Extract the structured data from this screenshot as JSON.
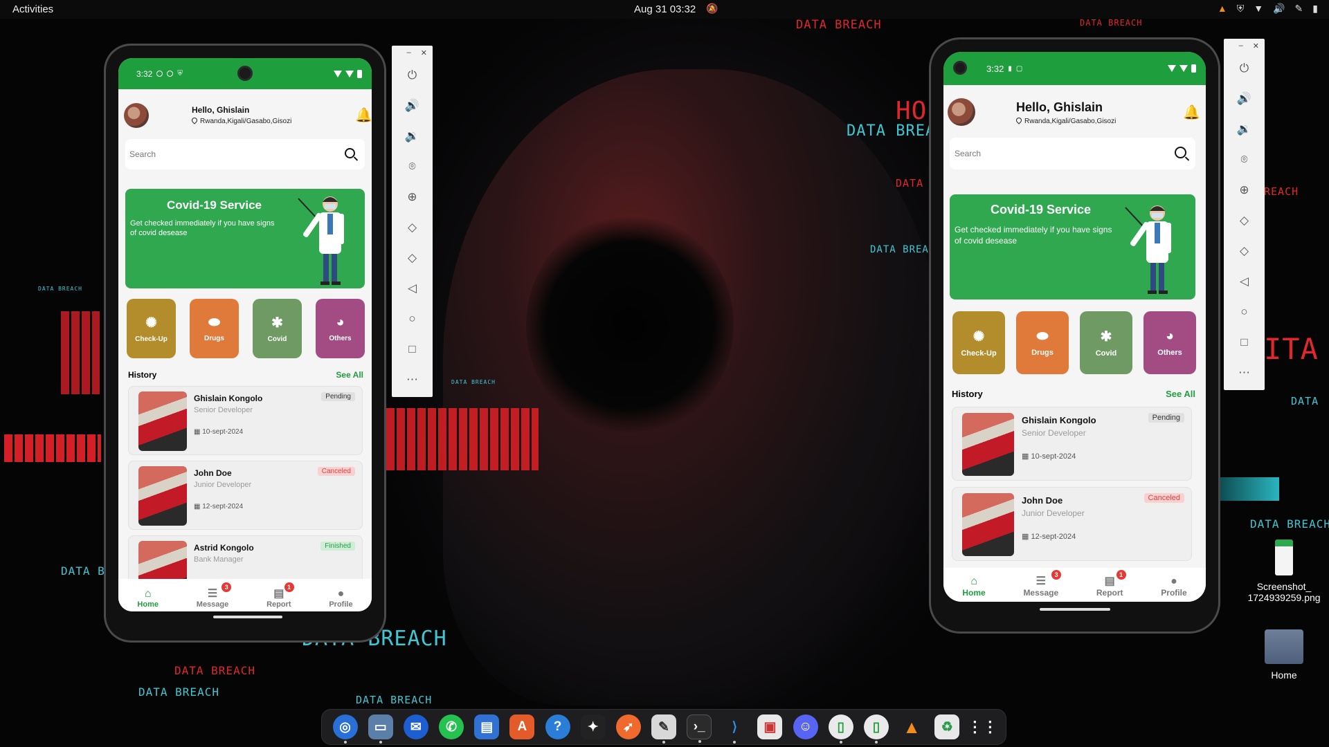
{
  "topbar": {
    "activities": "Activities",
    "datetime": "Aug 31  03:32"
  },
  "decor_texts": {
    "d1": "DATA BREACH",
    "d2": "DATA BREACH",
    "d3": "DATA BREA",
    "d4": "DATA",
    "d5": "DATA BREAC",
    "d6": "REACH",
    "d7": "DATA",
    "d8": "DATA BREACH",
    "d9": "DATA BREACH",
    "d10": "DATA BREACH",
    "d11": "DATA BREACH",
    "d12": "DATA BR",
    "d13": "DATA BREACH",
    "d14": "DATA BREACH",
    "d15": "DATA BREACH",
    "d16": "HO",
    "d17": "ITA"
  },
  "app": {
    "status_time": "3:32",
    "greeting": "Hello, Ghislain",
    "location": "Rwanda,Kigali/Gasabo,Gisozi",
    "search_placeholder": "Search",
    "banner_title": "Covid-19 Service",
    "banner_text": "Get checked immediately if you have signs of covid desease",
    "categories": [
      {
        "label": "Check-Up",
        "icon": "gear-icon",
        "color": "#b38d2c"
      },
      {
        "label": "Drugs",
        "icon": "pills-icon",
        "color": "#e07a3a"
      },
      {
        "label": "Covid",
        "icon": "virus-icon",
        "color": "#6f9a63"
      },
      {
        "label": "Others",
        "icon": "pie-chart-icon",
        "color": "#a34c83"
      }
    ],
    "history_title": "History",
    "see_all": "See All",
    "history": [
      {
        "name": "Ghislain Kongolo",
        "job": "Senior Developer",
        "date": "10-sept-2024",
        "status": "Pending"
      },
      {
        "name": "John Doe",
        "job": "Junior Developer",
        "date": "12-sept-2024",
        "status": "Canceled"
      },
      {
        "name": "Astrid Kongolo",
        "job": "Bank Manager",
        "date": "",
        "status": "Finished"
      }
    ],
    "nav": [
      {
        "label": "Home",
        "badge": ""
      },
      {
        "label": "Message",
        "badge": "3"
      },
      {
        "label": "Report",
        "badge": "1"
      },
      {
        "label": "Profile",
        "badge": ""
      }
    ]
  },
  "desktop": {
    "screenshot_file": "Screenshot_\n1724939259.png",
    "home_label": "Home"
  }
}
